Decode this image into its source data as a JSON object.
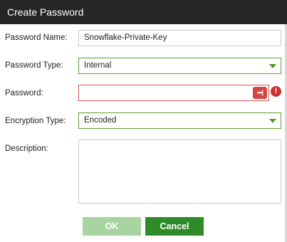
{
  "dialog": {
    "title": "Create Password"
  },
  "form": {
    "password_name": {
      "label": "Password Name:",
      "value": "Snowflake-Private-Key"
    },
    "password_type": {
      "label": "Password Type:",
      "value": "Internal"
    },
    "password": {
      "label": "Password:",
      "value": "",
      "reveal_glyph": "•••|",
      "error_glyph": "!"
    },
    "encryption_type": {
      "label": "Encryption Type:",
      "value": "Encoded"
    },
    "description": {
      "label": "Description:",
      "value": ""
    }
  },
  "buttons": {
    "ok_label": "OK",
    "cancel_label": "Cancel"
  },
  "colors": {
    "titlebar": "#252525",
    "accent_green": "#2f8a2a",
    "disabled_green": "#a7d4a0",
    "error_red": "#d64545"
  }
}
